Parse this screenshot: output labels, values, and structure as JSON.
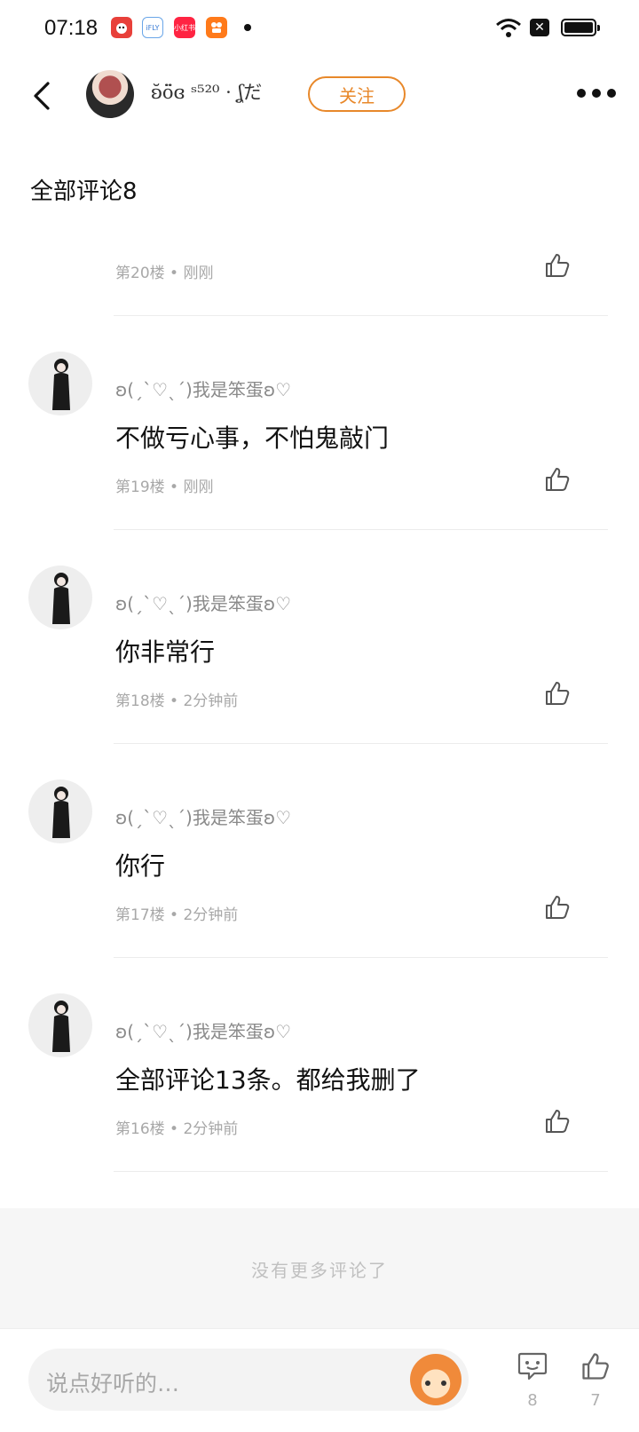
{
  "status_bar": {
    "time": "07:18",
    "app_icons": [
      {
        "name": "dog-app-icon",
        "label": "",
        "color": "#e8403a"
      },
      {
        "name": "iflytek-app-icon",
        "label": "iFLY",
        "color": "#ffffff"
      },
      {
        "name": "xiaohongshu-app-icon",
        "label": "小红书",
        "color": "#ff2442"
      },
      {
        "name": "kuaishou-app-icon",
        "label": "",
        "color": "#ff7a1a"
      }
    ]
  },
  "header": {
    "author_name": "ʚ̆ö̈ɞ ˢ⁵²⁰ · ʆだ",
    "follow_label": "关注"
  },
  "section_title": "全部评论8",
  "comments": [
    {
      "name": "",
      "text": "",
      "meta": "第20楼 • 刚刚"
    },
    {
      "name": "ʚ(ˏˋ♡ˎˊ)我是笨蛋ʚ♡",
      "text": "不做亏心事，不怕鬼敲门",
      "meta": "第19楼 • 刚刚"
    },
    {
      "name": "ʚ(ˏˋ♡ˎˊ)我是笨蛋ʚ♡",
      "text": "你非常行",
      "meta": "第18楼 • 2分钟前"
    },
    {
      "name": "ʚ(ˏˋ♡ˎˊ)我是笨蛋ʚ♡",
      "text": "你行",
      "meta": "第17楼 • 2分钟前"
    },
    {
      "name": "ʚ(ˏˋ♡ˎˊ)我是笨蛋ʚ♡",
      "text": "全部评论13条。都给我删了",
      "meta": "第16楼 • 2分钟前"
    }
  ],
  "no_more_text": "没有更多评论了",
  "bottom_bar": {
    "input_placeholder": "说点好听的…",
    "comment_count": "8",
    "like_count": "7"
  },
  "colors": {
    "accent": "#e8882a",
    "muted_text": "#a8a8a8",
    "divider": "#ececec"
  }
}
